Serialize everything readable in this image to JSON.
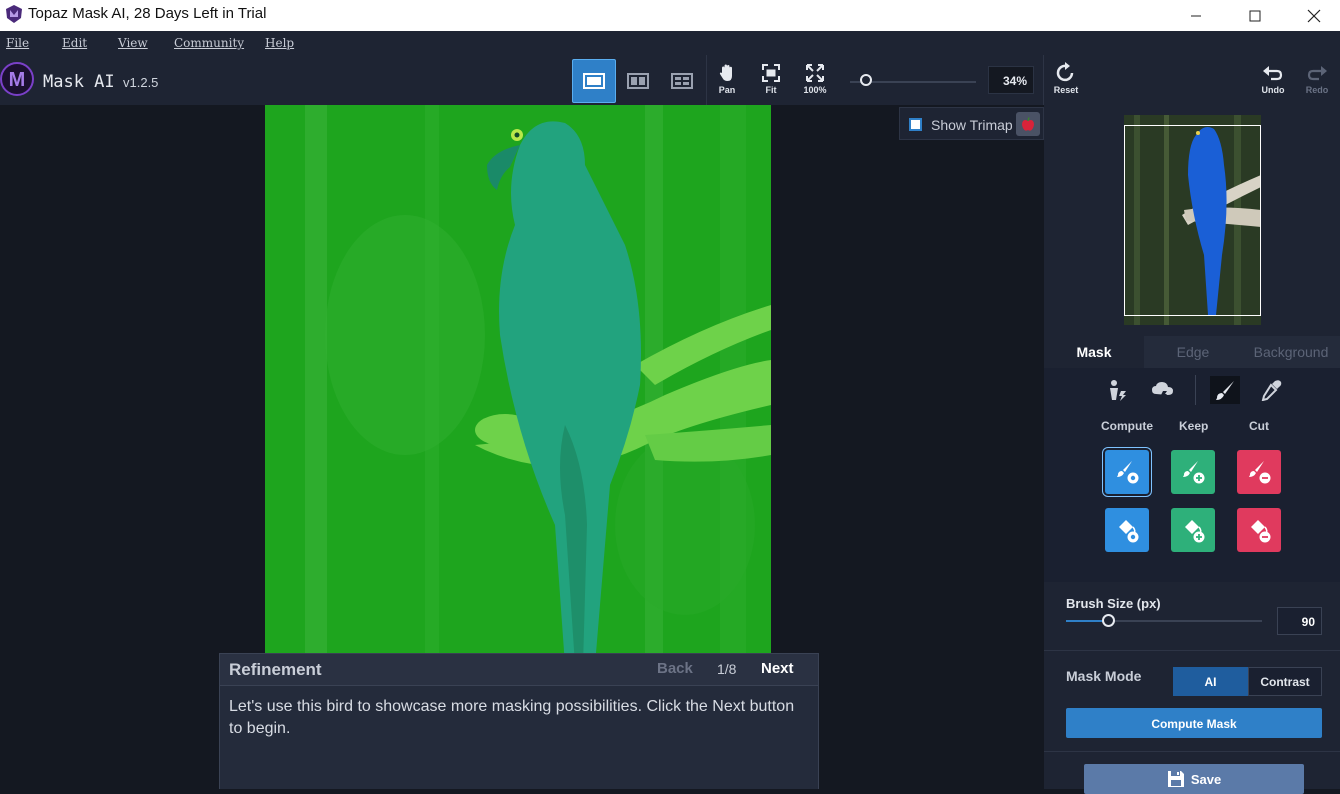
{
  "window": {
    "title": "Topaz Mask AI, 28 Days Left in Trial",
    "minimize_icon": "minimize-icon",
    "maximize_icon": "maximize-icon",
    "close_icon": "close-icon"
  },
  "menu": [
    "File",
    "Edit",
    "View",
    "Community",
    "Help"
  ],
  "app": {
    "logo_letter": "M",
    "name": "Mask AI",
    "version": "v1.2.5"
  },
  "toolbar": {
    "views": [
      "single-view-icon",
      "split-view-icon",
      "side-by-side-view-icon"
    ],
    "pan_label": "Pan",
    "fit_label": "Fit",
    "full_label": "100%",
    "zoom_value": "34%",
    "zoom_level_fraction": 0.05,
    "reset_label": "Reset",
    "undo_label": "Undo",
    "redo_label": "Redo"
  },
  "canvas": {
    "show_trimap_label": "Show Trimap",
    "overlay_color": "#22b422"
  },
  "refinement": {
    "title": "Refinement",
    "back": "Back",
    "step": "1/8",
    "next": "Next",
    "text": "Let's use this bird to showcase more masking possibilities. Click the Next button to begin."
  },
  "panel": {
    "tabs": [
      "Mask",
      "Edge",
      "Background"
    ],
    "columns": [
      "Compute",
      "Keep",
      "Cut"
    ],
    "colors": {
      "compute": "#2f8fe0",
      "keep": "#2eb07a",
      "cut": "#e03a5e",
      "accent": "#2f80c8"
    },
    "brush_size_label": "Brush Size (px)",
    "brush_size_value": "90",
    "mask_mode_label": "Mask Mode",
    "mask_mode_ai": "AI",
    "mask_mode_contrast": "Contrast",
    "compute_mask": "Compute Mask",
    "save": "Save"
  }
}
